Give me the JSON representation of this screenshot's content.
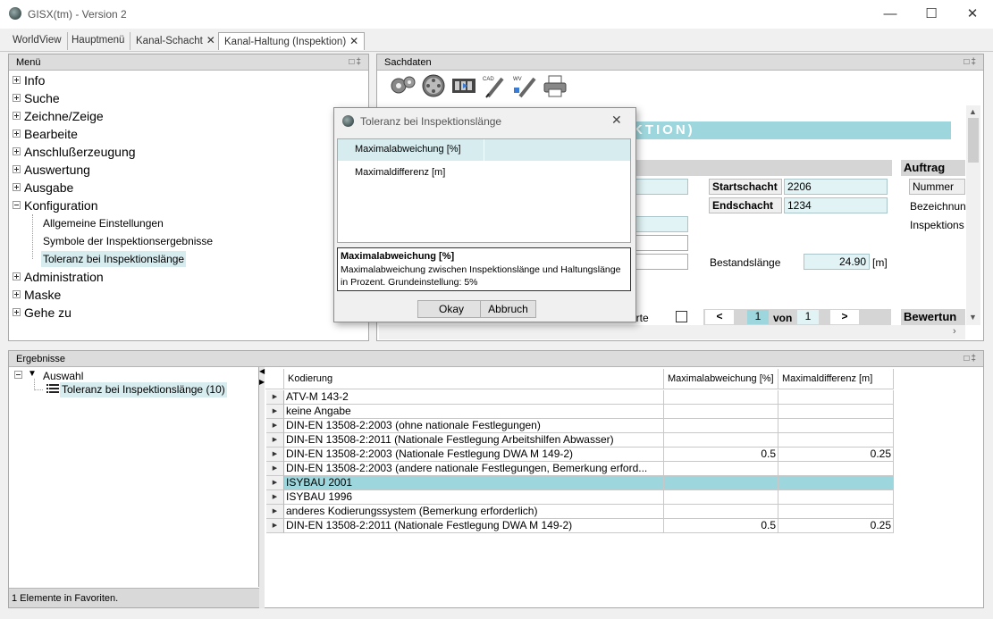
{
  "window": {
    "title": "GISX(tm) - Version 2"
  },
  "tabs": [
    {
      "label": "WorldView"
    },
    {
      "label": "Hauptmenü"
    },
    {
      "label": "Kanal-Schacht"
    },
    {
      "label": "Kanal-Haltung (Inspektion)"
    }
  ],
  "menu_panel": {
    "title": "Menü",
    "items": [
      "Info",
      "Suche",
      "Zeichne/Zeige",
      "Bearbeite",
      "Anschlußerzeugung",
      "Auswertung",
      "Ausgabe",
      "Konfiguration"
    ],
    "sub_items": [
      "Allgemeine Einstellungen",
      "Symbole der Inspektionsergebnisse",
      "Toleranz bei Inspektionslänge"
    ],
    "items_after": [
      "Administration",
      "Maske",
      "Gehe zu"
    ]
  },
  "sach_panel": {
    "title": "Sachdaten",
    "banner": "KTION)",
    "auftrag": "Auftrag",
    "startschacht_label": "Startschacht",
    "startschacht_value": "2206",
    "endschacht_label": "Endschacht",
    "endschacht_value": "1234",
    "nummer_label": "Nummer",
    "bezeichnung_label": "Bezeichnun",
    "inspektion_label": "Inspektions",
    "bestand_label": "Bestandslänge",
    "bestand_value": "24.90",
    "bestand_unit": "[m]",
    "werte_label": "erte",
    "nav_prev": "<",
    "nav_page": "1",
    "nav_von": "von",
    "nav_total": "1",
    "nav_next": ">",
    "bewertung": "Bewertun"
  },
  "dialog": {
    "title": "Toleranz bei Inspektionslänge",
    "list": [
      "Maximalabweichung [%]",
      "Maximaldifferenz [m]"
    ],
    "desc_title": "Maximalabweichung [%]",
    "desc_line1": "Maximalabweichung zwischen Inspektionslänge und Haltungslänge",
    "desc_line2": "in Prozent. Grundeinstellung: 5%",
    "ok_label": "Okay",
    "cancel_label": "Abbruch"
  },
  "results_panel": {
    "title": "Ergebnisse",
    "tree_root": "Auswahl",
    "tree_child": "Toleranz bei Inspektionslänge (10)",
    "status": "1 Elemente in Favoriten."
  },
  "grid": {
    "columns": [
      "Kodierung",
      "Maximalabweichung [%]",
      "Maximaldifferenz [m]"
    ],
    "rows": [
      {
        "kodierung": "ATV-M 143-2",
        "abw": "",
        "diff": ""
      },
      {
        "kodierung": "keine Angabe",
        "abw": "",
        "diff": ""
      },
      {
        "kodierung": "DIN-EN 13508-2:2003 (ohne nationale Festlegungen)",
        "abw": "",
        "diff": ""
      },
      {
        "kodierung": "DIN-EN 13508-2:2011 (Nationale Festlegung Arbeitshilfen Abwasser)",
        "abw": "",
        "diff": ""
      },
      {
        "kodierung": "DIN-EN 13508-2:2003 (Nationale Festlegung DWA M 149-2)",
        "abw": "0.5",
        "diff": "0.25"
      },
      {
        "kodierung": "DIN-EN 13508-2:2003 (andere nationale Festlegungen, Bemerkung erford...",
        "abw": "",
        "diff": ""
      },
      {
        "kodierung": "ISYBAU 2001",
        "abw": "",
        "diff": ""
      },
      {
        "kodierung": "ISYBAU 1996",
        "abw": "",
        "diff": ""
      },
      {
        "kodierung": "anderes Kodierungssystem (Bemerkung erforderlich)",
        "abw": "",
        "diff": ""
      },
      {
        "kodierung": "DIN-EN 13508-2:2011 (Nationale Festlegung DWA M 149-2)",
        "abw": "0.5",
        "diff": "0.25"
      }
    ],
    "selected_row": 6
  },
  "colors": {
    "accent": "#9dd6dc",
    "selection": "#d6ecef"
  }
}
